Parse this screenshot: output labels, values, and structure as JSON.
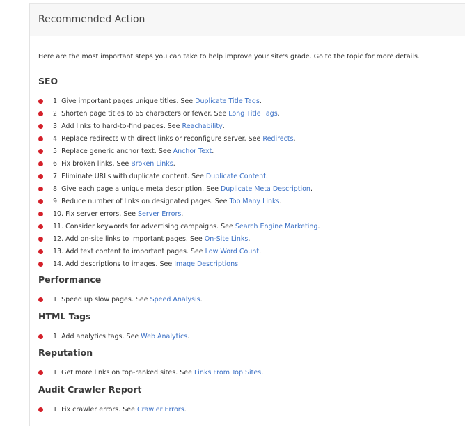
{
  "header": {
    "title": "Recommended Action"
  },
  "intro": "Here are the most important steps you can take to help improve your site's grade. Go to the topic for more details.",
  "sections": [
    {
      "title": "SEO",
      "items": [
        {
          "text": "1. Give important pages unique titles. See ",
          "link": "Duplicate Title Tags",
          "end": "."
        },
        {
          "text": "2. Shorten page titles to 65 characters or fewer. See ",
          "link": "Long Title Tags",
          "end": "."
        },
        {
          "text": "3. Add links to hard-to-find pages. See ",
          "link": "Reachability",
          "end": "."
        },
        {
          "text": "4. Replace redirects with direct links or reconfigure server. See ",
          "link": "Redirects",
          "end": "."
        },
        {
          "text": "5. Replace generic anchor text. See ",
          "link": "Anchor Text",
          "end": "."
        },
        {
          "text": "6. Fix broken links. See ",
          "link": "Broken Links",
          "end": "."
        },
        {
          "text": "7. Eliminate URLs with duplicate content. See ",
          "link": "Duplicate Content",
          "end": "."
        },
        {
          "text": "8. Give each page a unique meta description. See ",
          "link": "Duplicate Meta Description",
          "end": "."
        },
        {
          "text": "9. Reduce number of links on designated pages. See ",
          "link": "Too Many Links",
          "end": "."
        },
        {
          "text": "10. Fix server errors. See ",
          "link": "Server Errors",
          "end": "."
        },
        {
          "text": "11. Consider keywords for advertising campaigns. See ",
          "link": "Search Engine Marketing",
          "end": "."
        },
        {
          "text": "12. Add on-site links to important pages. See ",
          "link": "On-Site Links",
          "end": "."
        },
        {
          "text": "13. Add text content to important pages. See ",
          "link": "Low Word Count",
          "end": "."
        },
        {
          "text": "14. Add descriptions to images. See ",
          "link": "Image Descriptions",
          "end": "."
        }
      ]
    },
    {
      "title": "Performance",
      "items": [
        {
          "text": "1. Speed up slow pages. See ",
          "link": "Speed Analysis",
          "end": "."
        }
      ]
    },
    {
      "title": "HTML Tags",
      "items": [
        {
          "text": "1. Add analytics tags. See ",
          "link": "Web Analytics",
          "end": "."
        }
      ]
    },
    {
      "title": "Reputation",
      "items": [
        {
          "text": "1. Get more links on top-ranked sites. See ",
          "link": "Links From Top Sites",
          "end": "."
        }
      ]
    },
    {
      "title": "Audit Crawler Report",
      "items": [
        {
          "text": "1. Fix crawler errors. See ",
          "link": "Crawler Errors",
          "end": "."
        }
      ]
    }
  ],
  "colors": {
    "bullet": "#d4202a",
    "link": "#3a6fc4",
    "header_bg": "#f7f7f7"
  }
}
